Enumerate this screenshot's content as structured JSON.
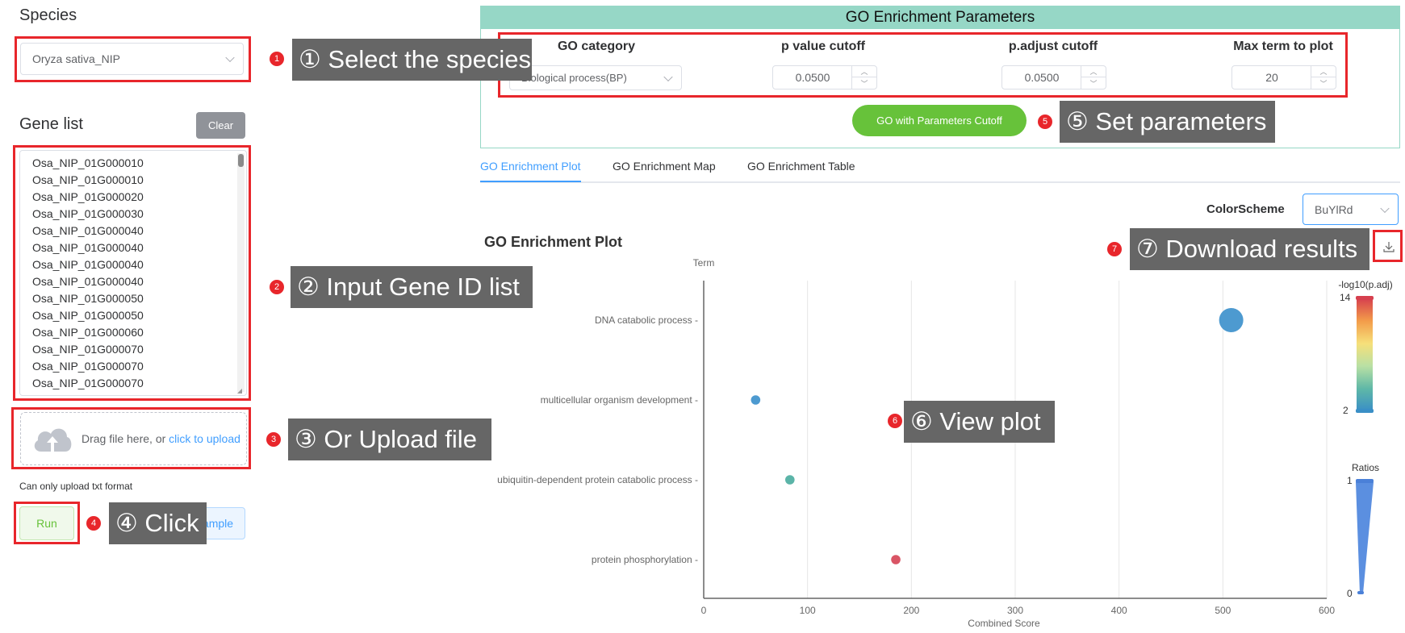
{
  "species": {
    "heading": "Species",
    "selected": "Oryza sativa_NIP"
  },
  "gene_list": {
    "heading": "Gene list",
    "clear_label": "Clear",
    "items": [
      "Osa_NIP_01G000010",
      "Osa_NIP_01G000010",
      "Osa_NIP_01G000020",
      "Osa_NIP_01G000030",
      "Osa_NIP_01G000040",
      "Osa_NIP_01G000040",
      "Osa_NIP_01G000040",
      "Osa_NIP_01G000040",
      "Osa_NIP_01G000050",
      "Osa_NIP_01G000050",
      "Osa_NIP_01G000060",
      "Osa_NIP_01G000070",
      "Osa_NIP_01G000070",
      "Osa_NIP_01G000070"
    ]
  },
  "upload": {
    "prefix": "Drag file here, or ",
    "link": "click to upload",
    "note": "Can only upload txt format",
    "icon": "cloud-upload-icon"
  },
  "actions": {
    "run_label": "Run",
    "example_label": "ample"
  },
  "params": {
    "title": "GO Enrichment Parameters",
    "go_category_label": "GO category",
    "go_category_value": "Biological process(BP)",
    "pvalue_label": "p value cutoff",
    "pvalue_value": "0.0500",
    "padjust_label": "p.adjust cutoff",
    "padjust_value": "0.0500",
    "maxterm_label": "Max term to plot",
    "maxterm_value": "20",
    "go_button": "GO with Parameters Cutoff"
  },
  "tabs": [
    "GO Enrichment Plot",
    "GO Enrichment Map",
    "GO Enrichment Table"
  ],
  "active_tab": 0,
  "color_scheme": {
    "label": "ColorScheme",
    "value": "BuYlRd"
  },
  "plot": {
    "title": "GO Enrichment Plot"
  },
  "callouts": [
    {
      "num": "1",
      "text": "① Select the species"
    },
    {
      "num": "2",
      "text": "② Input Gene ID list"
    },
    {
      "num": "3",
      "text": "③ Or Upload file"
    },
    {
      "num": "4",
      "text": "④ Click"
    },
    {
      "num": "5",
      "text": "⑤ Set parameters"
    },
    {
      "num": "6",
      "text": "⑥ View plot"
    },
    {
      "num": "7",
      "text": "⑦ Download results"
    }
  ],
  "colors": {
    "accent": "#409eff",
    "header_bg": "#96d7c6",
    "green": "#67c23a",
    "annotation_red": "#e8262b",
    "callout_bg": "#666666"
  },
  "chart_data": {
    "type": "scatter",
    "title": "",
    "xlabel": "Combined Score",
    "ylabel": "Term",
    "xlim": [
      0,
      600
    ],
    "x_ticks": [
      0,
      100,
      200,
      300,
      400,
      500,
      600
    ],
    "categories": [
      "DNA catabolic process",
      "multicellular organism development",
      "ubiquitin-dependent protein catabolic process",
      "protein phosphorylation"
    ],
    "x": [
      508,
      50,
      83,
      185
    ],
    "ratio": [
      1.0,
      0.08,
      0.08,
      0.08
    ],
    "point_colors": [
      "#4d9ad0",
      "#4d9ad0",
      "#5bb4a8",
      "#d95565"
    ],
    "color_legend": {
      "title": "-log10(p.adj)",
      "max": "14",
      "min": "2",
      "colors": [
        "#d6404e",
        "#f39c4a",
        "#f6e07a",
        "#b9e0a4",
        "#5fb8a7",
        "#3a8fc6"
      ]
    },
    "size_legend": {
      "title": "Ratios",
      "max": "1",
      "min": "0"
    },
    "grid": true
  }
}
